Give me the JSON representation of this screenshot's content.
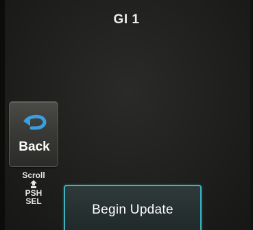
{
  "header": {
    "title": "GI 1"
  },
  "back_button": {
    "label": "Back",
    "icon": "back-arrow-icon",
    "icon_color": "#3a9fe0"
  },
  "knob_hint": {
    "line1": "Scroll",
    "icon": "knob-icon",
    "line2": "PSH",
    "line3": "SEL"
  },
  "primary_action": {
    "label": "Begin Update",
    "highlight_color": "#3fb4c2"
  }
}
